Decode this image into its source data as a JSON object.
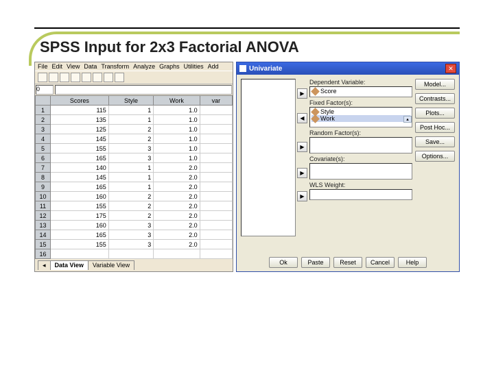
{
  "title": "SPSS Input for 2x3 Factorial ANOVA",
  "data_view": {
    "menus": [
      "File",
      "Edit",
      "View",
      "Data",
      "Transform",
      "Analyze",
      "Graphs",
      "Utilities",
      "Add"
    ],
    "cell_editor_label": "0",
    "columns": [
      "Scores",
      "Style",
      "Work",
      "var"
    ],
    "rows": [
      {
        "n": 1,
        "Scores": 115,
        "Style": 1,
        "Work": "1.0"
      },
      {
        "n": 2,
        "Scores": 135,
        "Style": 1,
        "Work": "1.0"
      },
      {
        "n": 3,
        "Scores": 125,
        "Style": 2,
        "Work": "1.0"
      },
      {
        "n": 4,
        "Scores": 145,
        "Style": 2,
        "Work": "1.0"
      },
      {
        "n": 5,
        "Scores": 155,
        "Style": 3,
        "Work": "1.0"
      },
      {
        "n": 6,
        "Scores": 165,
        "Style": 3,
        "Work": "1.0"
      },
      {
        "n": 7,
        "Scores": 140,
        "Style": 1,
        "Work": "2.0"
      },
      {
        "n": 8,
        "Scores": 145,
        "Style": 1,
        "Work": "2.0"
      },
      {
        "n": 9,
        "Scores": 165,
        "Style": 1,
        "Work": "2.0"
      },
      {
        "n": 10,
        "Scores": 160,
        "Style": 2,
        "Work": "2.0"
      },
      {
        "n": 11,
        "Scores": 155,
        "Style": 2,
        "Work": "2.0"
      },
      {
        "n": 12,
        "Scores": 175,
        "Style": 2,
        "Work": "2.0"
      },
      {
        "n": 13,
        "Scores": 160,
        "Style": 3,
        "Work": "2.0"
      },
      {
        "n": 14,
        "Scores": 165,
        "Style": 3,
        "Work": "2.0"
      },
      {
        "n": 15,
        "Scores": 155,
        "Style": 3,
        "Work": "2.0"
      },
      {
        "n": 16,
        "Scores": "",
        "Style": "",
        "Work": ""
      }
    ],
    "tabs": {
      "active": "Data View",
      "other": "Variable View"
    }
  },
  "dialog": {
    "title": "Univariate",
    "fields": {
      "dep_label": "Dependent Variable:",
      "dep_value": "Score",
      "fixed_label": "Fixed Factor(s):",
      "fixed_items": [
        "Style",
        "Work"
      ],
      "random_label": "Random Factor(s):",
      "cov_label": "Covariate(s):",
      "wls_label": "WLS Weight:"
    },
    "side_buttons": [
      "Model...",
      "Contrasts...",
      "Plots...",
      "Post Hoc...",
      "Save...",
      "Options..."
    ],
    "bottom_buttons": [
      "Ok",
      "Paste",
      "Reset",
      "Cancel",
      "Help"
    ]
  }
}
